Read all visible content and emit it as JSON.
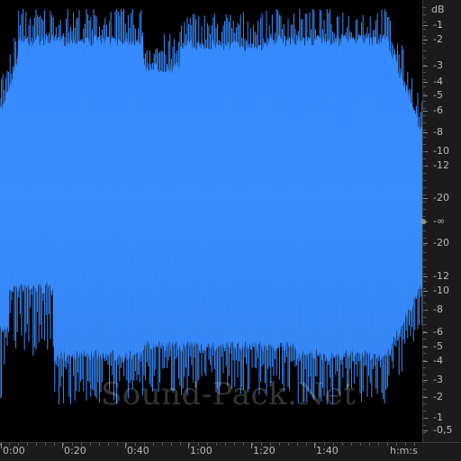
{
  "app": {
    "watermark": "Sound-Pack.Net",
    "waveform_color": "#2f86ff",
    "background_color": "#000000",
    "ruler_color": "#1b1b1b"
  },
  "db_ruler": {
    "unit": "dB",
    "labels": [
      "-1",
      "-2",
      "-3",
      "-4",
      "-5",
      "-6",
      "-8",
      "-10",
      "-12",
      "-20",
      "-∞",
      "-20",
      "-12",
      "-10",
      "-8",
      "-6",
      "-5",
      "-4",
      "-3",
      "-2",
      "-1",
      "-0,5"
    ]
  },
  "time_ruler": {
    "labels": [
      "0:00",
      "0:20",
      "0:40",
      "1:00",
      "1:20",
      "1:40"
    ],
    "unit": "h:m:s"
  }
}
